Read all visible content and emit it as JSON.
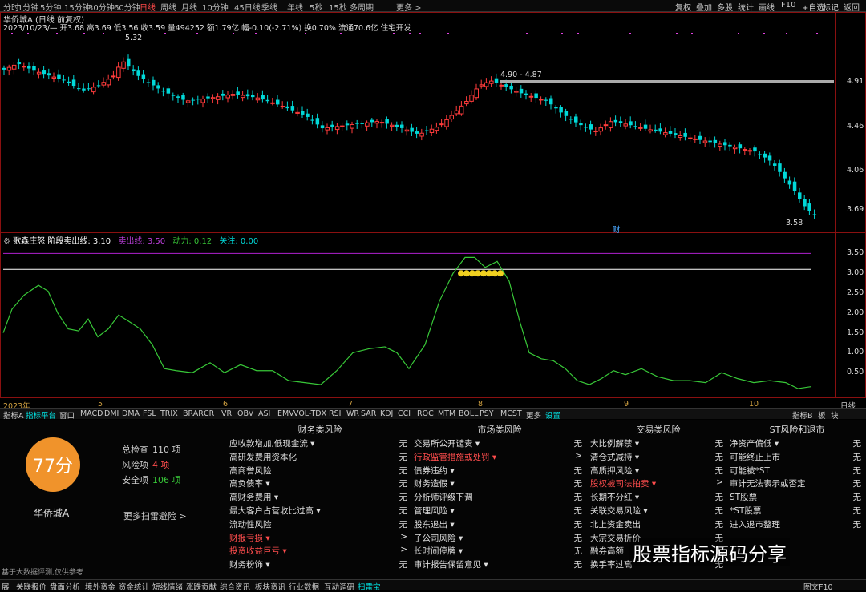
{
  "topbar": {
    "periods": [
      "分时",
      "1分钟",
      "5分钟",
      "15分钟",
      "30分钟",
      "60分钟",
      "日线",
      "周线",
      "月线",
      "10分钟",
      "45日线",
      "季线",
      "年线",
      "5秒",
      "15秒",
      "多周期",
      "更多 >"
    ],
    "active_period": "日线",
    "right_buttons": [
      "复权",
      "叠加",
      "多股",
      "统计",
      "画线",
      "F10",
      "+自选",
      "标记",
      "返回"
    ]
  },
  "stock": {
    "title": "华侨城A (日线 前复权)",
    "info_line": "2023/10/23/— 开3.68 高3.69 低3.56 收3.59 量494252 额1.79亿 幅-0.10(-2.71%) 换0.70% 流通70.6亿 住宅开发",
    "name": "华侨城A"
  },
  "price_axis": [
    "4.91",
    "4.46",
    "4.06",
    "3.69"
  ],
  "price_annotations": {
    "high": "5.32",
    "range": "4.90 - 4.87",
    "low": "3.58",
    "fin_marker": "财"
  },
  "indicator": {
    "header_label": "歌森庄怒 阶段卖出线: 3.10",
    "sell_line": "卖出线: 3.50",
    "power": "动力: 0.12",
    "attention": "关注: 0.00",
    "axis": [
      "3.50",
      "3.00",
      "2.50",
      "2.00",
      "1.50",
      "1.00",
      "0.50"
    ]
  },
  "dates": [
    "2023年",
    "5",
    "6",
    "7",
    "8",
    "9",
    "10"
  ],
  "date_right": "日线",
  "tabs": [
    "指标A",
    "指标平台",
    "窗口",
    "MACD",
    "DMI",
    "DMA",
    "FSL",
    "TRIX",
    "BRAR",
    "CR",
    "VR",
    "OBV",
    "ASI",
    "EMV",
    "VOL-TDX",
    "RSI",
    "WR",
    "SAR",
    "KDJ",
    "CCI",
    "ROC",
    "MTM",
    "BOLL",
    "PSY",
    "MCST",
    "更多",
    "设置"
  ],
  "tabs_right": [
    "指标B",
    "板",
    "块"
  ],
  "score": {
    "value": "77分",
    "total_label": "总检查",
    "total_value": "110 项",
    "risk_label": "风险项",
    "risk_value": "4 项",
    "safe_label": "安全项",
    "safe_value": "106 项",
    "more_link": "更多扫雷避险 >",
    "footnote": "基于大数据评测,仅供参考"
  },
  "risk_columns": [
    {
      "title": "财务类风险",
      "items": [
        {
          "label": "应收款增加,低现金流 ▾",
          "value": "无",
          "red": false
        },
        {
          "label": "高研发费用资本化",
          "value": "无",
          "red": false
        },
        {
          "label": "高商誉风险",
          "value": "无",
          "red": false
        },
        {
          "label": "高负债率 ▾",
          "value": "无",
          "red": false
        },
        {
          "label": "高财务费用 ▾",
          "value": "无",
          "red": false
        },
        {
          "label": "最大客户占营收比过高 ▾",
          "value": "无",
          "red": false
        },
        {
          "label": "流动性风险",
          "value": "无",
          "red": false
        },
        {
          "label": "财报亏损 ▾",
          "value": ">",
          "red": true
        },
        {
          "label": "投资收益巨亏 ▾",
          "value": ">",
          "red": true
        },
        {
          "label": "财务粉饰 ▾",
          "value": "无",
          "red": false
        }
      ]
    },
    {
      "title": "市场类风险",
      "items": [
        {
          "label": "交易所公开谴责 ▾",
          "value": "无",
          "red": false
        },
        {
          "label": "行政监管措施或处罚 ▾",
          "value": ">",
          "red": true
        },
        {
          "label": "债券违约 ▾",
          "value": "无",
          "red": false
        },
        {
          "label": "财务造假 ▾",
          "value": "无",
          "red": false
        },
        {
          "label": "分析师评级下调",
          "value": "无",
          "red": false
        },
        {
          "label": "管理风险 ▾",
          "value": "无",
          "red": false
        },
        {
          "label": "股东退出 ▾",
          "value": "无",
          "red": false
        },
        {
          "label": "子公司风险 ▾",
          "value": "无",
          "red": false
        },
        {
          "label": "长时间停牌 ▾",
          "value": "无",
          "red": false
        },
        {
          "label": "审计报告保留意见 ▾",
          "value": "无",
          "red": false
        }
      ]
    },
    {
      "title": "交易类风险",
      "items": [
        {
          "label": "大比例解禁 ▾",
          "value": "无",
          "red": false
        },
        {
          "label": "清仓式减持 ▾",
          "value": "无",
          "red": false
        },
        {
          "label": "高质押风险 ▾",
          "value": "无",
          "red": false
        },
        {
          "label": "股权被司法拍卖 ▾",
          "value": ">",
          "red": true
        },
        {
          "label": "长期不分红 ▾",
          "value": "无",
          "red": false
        },
        {
          "label": "关联交易风险 ▾",
          "value": "无",
          "red": false
        },
        {
          "label": "北上资金卖出",
          "value": "无",
          "red": false
        },
        {
          "label": "大宗交易折价",
          "value": "无",
          "red": false
        },
        {
          "label": "融券高额",
          "value": "无",
          "red": false
        },
        {
          "label": "换手率过高",
          "value": "无",
          "red": false
        }
      ]
    },
    {
      "title": "ST风险和退市",
      "items": [
        {
          "label": "净资产偏低 ▾",
          "value": "无",
          "red": false
        },
        {
          "label": "可能终止上市",
          "value": "无",
          "red": false
        },
        {
          "label": "可能被*ST",
          "value": "无",
          "red": false
        },
        {
          "label": "审计无法表示或否定",
          "value": "无",
          "red": false
        },
        {
          "label": "ST股票",
          "value": "无",
          "red": false
        },
        {
          "label": "*ST股票",
          "value": "无",
          "red": false
        },
        {
          "label": "进入退市整理",
          "value": "无",
          "red": false
        }
      ]
    }
  ],
  "statusbar": [
    "展",
    "关联报价",
    "盘面分析",
    "境外资金",
    "资金统计",
    "短线情绪",
    "涨跌贡献",
    "综合资讯",
    "板块资讯",
    "行业数据",
    "互动调研",
    "扫雷宝"
  ],
  "statusbar_right": "图文F10",
  "watermark": "股票指标源码分享",
  "colors": {
    "up": "#ff3b3b",
    "down": "#00d8d8",
    "osc": "#38c838",
    "sell": "#b020d0",
    "stage": "#ffffff",
    "score": "#f0932b"
  }
}
